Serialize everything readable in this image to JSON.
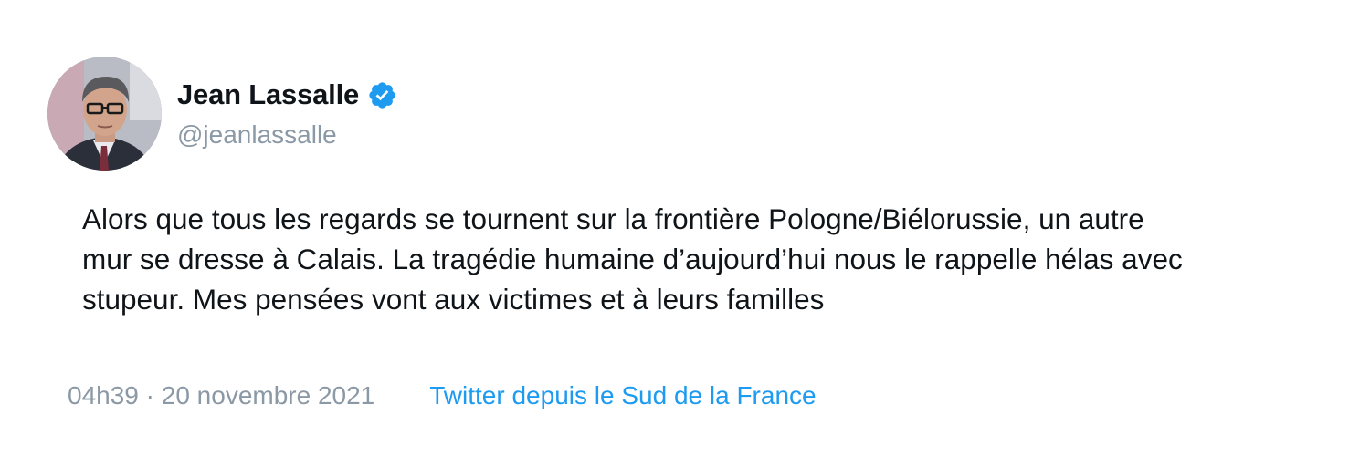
{
  "author": {
    "display_name": "Jean Lassalle",
    "handle": "@jeanlassalle",
    "verified": true,
    "verified_icon": "verified-badge-icon",
    "avatar_icon": "profile-photo"
  },
  "tweet": {
    "text_lines": [
      "Alors que tous les regards se tournent sur la frontière Pologne/Biélorussie, un autre",
      "mur se dresse à Calais. La tragédie humaine d’aujourd’hui nous le rappelle hélas avec",
      "stupeur. Mes pensées vont aux victimes et à leurs familles"
    ]
  },
  "meta": {
    "timestamp": "04h39 · 20 novembre 2021",
    "source": "Twitter depuis le Sud de la France"
  },
  "colors": {
    "text": "#0f1419",
    "secondary": "#8b98a5",
    "link": "#1d9bf0",
    "verified": "#1d9bf0"
  }
}
